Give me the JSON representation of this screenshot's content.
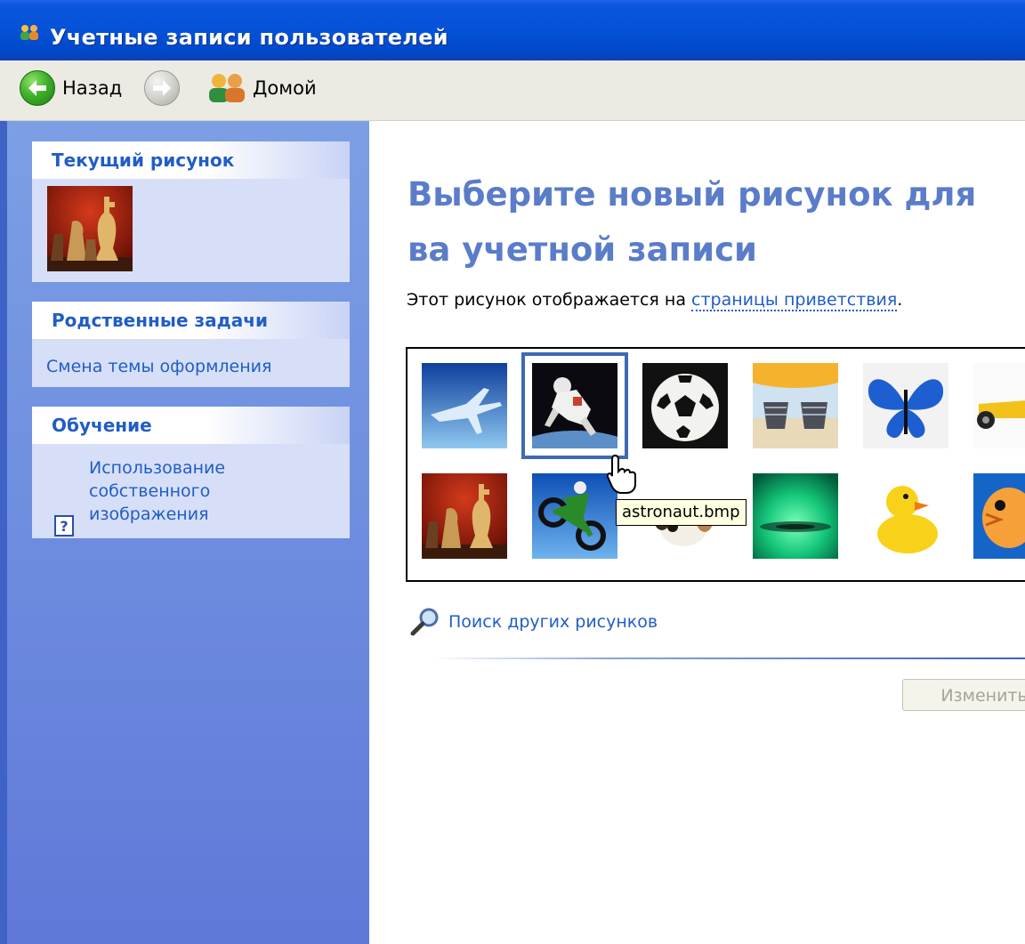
{
  "window": {
    "title": "Учетные записи пользователей"
  },
  "toolbar": {
    "back_label": "Назад",
    "home_label": "Домой"
  },
  "sidebar": {
    "current_picture": {
      "title": "Текущий рисунок"
    },
    "related_tasks": {
      "title": "Родственные задачи",
      "items": [
        "Смена темы оформления"
      ]
    },
    "learn": {
      "title": "Обучение",
      "items": [
        "Использование собственного изображения"
      ]
    }
  },
  "main": {
    "heading": "Выберите новый рисунок для ва учетной записи",
    "description_prefix": "Этот рисунок отображается на ",
    "description_link": "страницы приветствия",
    "description_suffix": ".",
    "tooltip": "astronaut.bmp",
    "selected_picture": "astronaut",
    "pictures_row1": [
      "airplane",
      "astronaut",
      "soccer-ball",
      "beach-chairs",
      "butterfly",
      "car"
    ],
    "pictures_row2": [
      "chess",
      "dirt-bike",
      "dog",
      "drip",
      "duck",
      "fish"
    ],
    "search_link": "Поиск других рисунков",
    "change_button": "Изменить"
  },
  "colors": {
    "titlebar": "#0451d6",
    "sidebar": "#6f8fe0",
    "link": "#215dc6",
    "heading": "#5a7cc9"
  }
}
